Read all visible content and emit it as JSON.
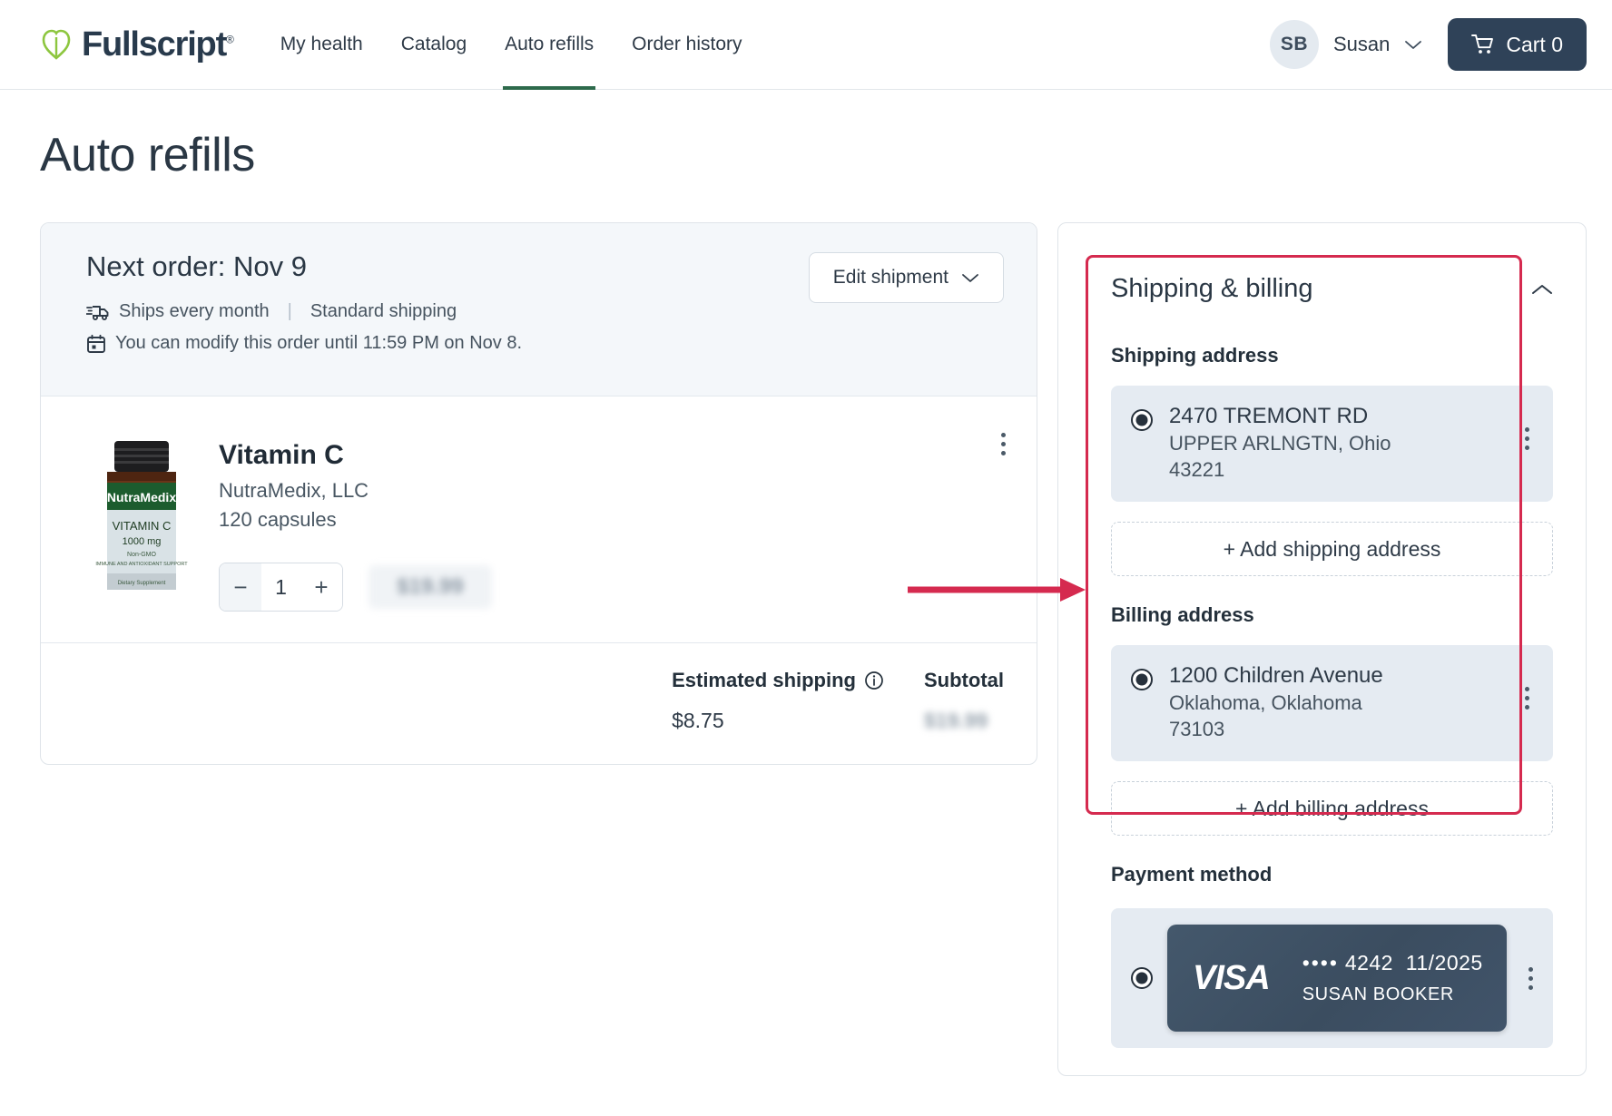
{
  "header": {
    "brand": "Fullscript",
    "brand_trademark": "®",
    "nav": [
      {
        "label": "My health",
        "active": false
      },
      {
        "label": "Catalog",
        "active": false
      },
      {
        "label": "Auto refills",
        "active": true
      },
      {
        "label": "Order history",
        "active": false
      }
    ],
    "avatar_initials": "SB",
    "user_name": "Susan",
    "cart_label": "Cart 0"
  },
  "page": {
    "title": "Auto refills"
  },
  "order": {
    "next_order_title": "Next order: Nov 9",
    "ship_frequency": "Ships every month",
    "separator": "|",
    "shipping_type": "Standard shipping",
    "modify_notice": "You can modify this order until 11:59 PM on Nov 8.",
    "edit_shipment_label": "Edit shipment",
    "product": {
      "name": "Vitamin C",
      "brand": "NutraMedix, LLC",
      "size": "120 capsules",
      "quantity": "1",
      "minus_label": "−",
      "plus_label": "+",
      "price_hidden": "$19.99"
    },
    "totals": {
      "shipping_label": "Estimated shipping",
      "shipping_value": "$8.75",
      "subtotal_label": "Subtotal",
      "subtotal_value": "$19.99"
    }
  },
  "sidebar": {
    "section_title": "Shipping & billing",
    "shipping_address_label": "Shipping address",
    "shipping_address": {
      "line1": "2470 TREMONT RD",
      "line2": "UPPER ARLNGTN, Ohio",
      "line3": "43221"
    },
    "add_shipping_label": "+ Add shipping address",
    "billing_address_label": "Billing address",
    "billing_address": {
      "line1": "1200 Children Avenue",
      "line2": "Oklahoma, Oklahoma",
      "line3": "73103"
    },
    "add_billing_label": "+ Add billing address",
    "payment_method_label": "Payment method",
    "card": {
      "brand": "VISA",
      "dots": "••••",
      "last4": "4242",
      "expiry": "11/2025",
      "holder": "SUSAN BOOKER"
    }
  },
  "annotation": {
    "highlight_color": "#d52a4f",
    "arrow_color": "#d52a4f"
  }
}
